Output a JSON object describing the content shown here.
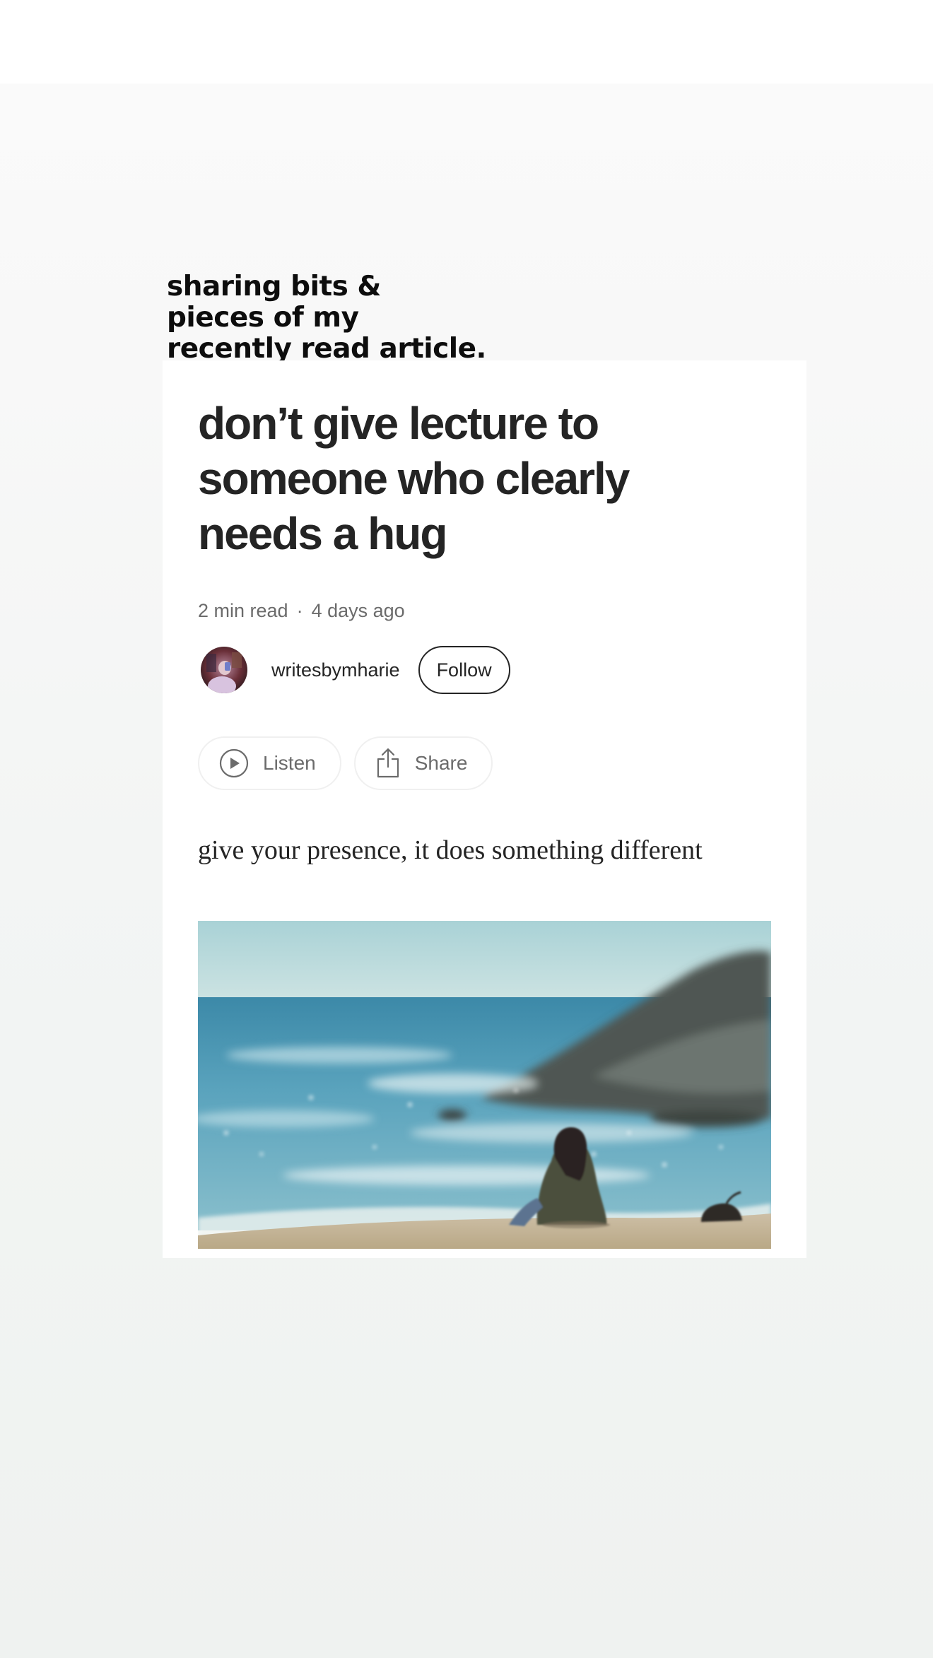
{
  "caption": {
    "lines": [
      "sharing bits &",
      "pieces of my",
      "recently read article."
    ]
  },
  "article": {
    "title_lines": [
      "don’t give lecture to",
      "someone who clearly",
      "needs a hug"
    ],
    "read_time": "2 min read",
    "separator": "·",
    "published": "4 days ago",
    "author": "writesbymharie",
    "follow_label": "Follow",
    "listen_label": "Listen",
    "share_label": "Share",
    "subtitle": "give your presence, it does something different"
  },
  "icons": {
    "listen": "play-circle-icon",
    "share": "share-upload-icon"
  },
  "colors": {
    "text": "#242424",
    "muted": "#6b6b6b",
    "pill_border": "#f0f0f0",
    "background": "#f3f5f4"
  }
}
